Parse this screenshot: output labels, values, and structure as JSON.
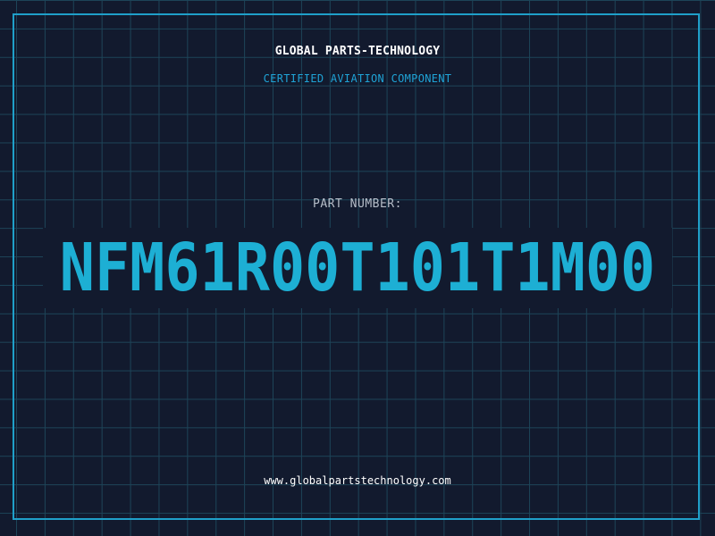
{
  "header": {
    "company": "GLOBAL PARTS-TECHNOLOGY",
    "tagline": "CERTIFIED AVIATION COMPONENT"
  },
  "part": {
    "label": "PART NUMBER:",
    "number": "NFM61R00T101T1M00"
  },
  "footer": {
    "website": "www.globalpartstechnology.com"
  },
  "colors": {
    "background": "#121a2e",
    "grid": "#1d4458",
    "frame": "#1f9fc9",
    "accent": "#1dafd4",
    "heading": "#ffffff",
    "label": "#b7bec9"
  }
}
